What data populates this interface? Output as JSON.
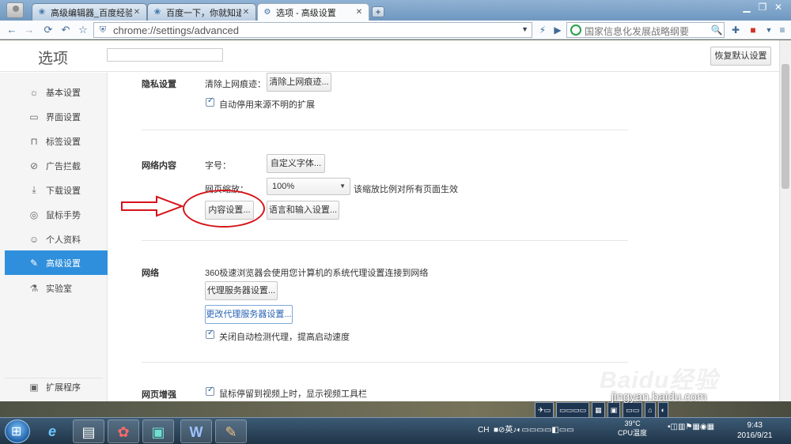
{
  "browser": {
    "tabs": [
      {
        "label": "高级编辑器_百度经验",
        "icon": "baidu-paw-icon"
      },
      {
        "label": "百度一下，你就知道",
        "icon": "baidu-paw-icon"
      },
      {
        "label": "选项 - 高级设置",
        "icon": "gear-icon"
      }
    ],
    "new_tab": "+",
    "url": "chrome://settings/advanced",
    "search_placeholder": "国家信息化发展战略纲要"
  },
  "settings": {
    "title": "选项",
    "restore_button": "恢复默认设置",
    "nav": [
      {
        "label": "基本设置",
        "icon": "gear-icon"
      },
      {
        "label": "界面设置",
        "icon": "window-icon"
      },
      {
        "label": "标签设置",
        "icon": "tab-icon"
      },
      {
        "label": "广告拦截",
        "icon": "block-icon"
      },
      {
        "label": "下载设置",
        "icon": "download-icon"
      },
      {
        "label": "鼠标手势",
        "icon": "mouse-icon"
      },
      {
        "label": "个人资料",
        "icon": "person-icon"
      },
      {
        "label": "高级设置",
        "icon": "wrench-icon",
        "active": true
      },
      {
        "label": "实验室",
        "icon": "flask-icon"
      }
    ],
    "nav_footer": {
      "label": "扩展程序",
      "icon": "extension-icon"
    },
    "privacy": {
      "section": "隐私设置",
      "clear_label": "清除上网痕迹：",
      "clear_button": "清除上网痕迹...",
      "auto_disable_ext": "自动停用来源不明的扩展"
    },
    "web_content": {
      "section": "网络内容",
      "font_label": "字号：",
      "custom_font_button": "自定义字体...",
      "zoom_label": "网页缩放：",
      "zoom_value": "100%",
      "zoom_note": "该缩放比例对所有页面生效",
      "content_settings_button": "内容设置...",
      "language_button": "语言和输入设置..."
    },
    "network": {
      "section": "网络",
      "description": "360极速浏览器会使用您计算机的系统代理设置连接到网络",
      "proxy_button": "代理服务器设置...",
      "change_proxy_button": "更改代理服务器设置...",
      "auto_detect": "关闭自动检测代理，提高启动速度"
    },
    "web_enhance": {
      "section": "网页增强",
      "video_toolbar": "鼠标停留到视频上时，显示视频工具栏"
    }
  },
  "taskbar": {
    "tray_lang": "CH",
    "cpu_temp": "39°C",
    "cpu_label": "CPU温度",
    "time": "9:43",
    "date": "2016/9/21"
  },
  "watermark": {
    "brand": "Baidu经验",
    "url": "jingyan.baidu.com"
  }
}
